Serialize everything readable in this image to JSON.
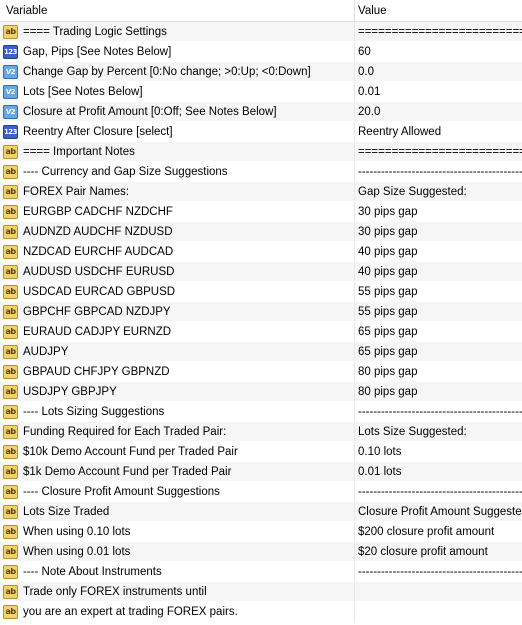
{
  "header": {
    "variable": "Variable",
    "value": "Value"
  },
  "rows": [
    {
      "icon": "ab-icon",
      "type": "ab",
      "var": "==== Trading Logic Settings",
      "val": "=================================="
    },
    {
      "icon": "int-icon",
      "type": "num",
      "var": "Gap, Pips [See Notes Below]",
      "val": "60"
    },
    {
      "icon": "double-icon",
      "type": "dbl",
      "var": "Change Gap by Percent [0:No change; >0:Up; <0:Down]",
      "val": "0.0"
    },
    {
      "icon": "double-icon",
      "type": "dbl",
      "var": "Lots [See Notes Below]",
      "val": "0.01"
    },
    {
      "icon": "double-icon",
      "type": "dbl",
      "var": "Closure at Profit Amount [0:Off; See Notes Below]",
      "val": "20.0"
    },
    {
      "icon": "int-icon",
      "type": "num",
      "var": "Reentry After Closure [select]",
      "val": "Reentry Allowed"
    },
    {
      "icon": "ab-icon",
      "type": "ab",
      "var": "==== Important Notes",
      "val": "=================================="
    },
    {
      "icon": "ab-icon",
      "type": "ab",
      "var": "---- Currency and Gap Size Suggestions",
      "val": "---------------------------------------------"
    },
    {
      "icon": "ab-icon",
      "type": "ab",
      "var": "FOREX Pair Names:",
      "val": "Gap Size Suggested:"
    },
    {
      "icon": "ab-icon",
      "type": "ab",
      "var": "EURGBP CADCHF NZDCHF",
      "val": "30 pips gap"
    },
    {
      "icon": "ab-icon",
      "type": "ab",
      "var": "AUDNZD AUDCHF NZDUSD",
      "val": "30 pips gap"
    },
    {
      "icon": "ab-icon",
      "type": "ab",
      "var": "NZDCAD EURCHF AUDCAD",
      "val": "40 pips gap"
    },
    {
      "icon": "ab-icon",
      "type": "ab",
      "var": "AUDUSD USDCHF EURUSD",
      "val": "40 pips gap"
    },
    {
      "icon": "ab-icon",
      "type": "ab",
      "var": "USDCAD EURCAD GBPUSD",
      "val": "55 pips gap"
    },
    {
      "icon": "ab-icon",
      "type": "ab",
      "var": "GBPCHF GBPCAD NZDJPY",
      "val": "55 pips gap"
    },
    {
      "icon": "ab-icon",
      "type": "ab",
      "var": "EURAUD CADJPY EURNZD",
      "val": "65 pips gap"
    },
    {
      "icon": "ab-icon",
      "type": "ab",
      "var": "AUDJPY",
      "val": "65 pips gap"
    },
    {
      "icon": "ab-icon",
      "type": "ab",
      "var": "GBPAUD CHFJPY GBPNZD",
      "val": "80 pips gap"
    },
    {
      "icon": "ab-icon",
      "type": "ab",
      "var": "USDJPY GBPJPY",
      "val": "80 pips gap"
    },
    {
      "icon": "ab-icon",
      "type": "ab",
      "var": "---- Lots Sizing Suggestions",
      "val": "---------------------------------------------"
    },
    {
      "icon": "ab-icon",
      "type": "ab",
      "var": "Funding Required for Each Traded Pair:",
      "val": "Lots Size Suggested:"
    },
    {
      "icon": "ab-icon",
      "type": "ab",
      "var": "$10k Demo Account Fund per Traded Pair",
      "val": "0.10 lots"
    },
    {
      "icon": "ab-icon",
      "type": "ab",
      "var": "$1k Demo Account Fund per Traded Pair",
      "val": "0.01 lots"
    },
    {
      "icon": "ab-icon",
      "type": "ab",
      "var": "---- Closure Profit Amount Suggestions",
      "val": "---------------------------------------------"
    },
    {
      "icon": "ab-icon",
      "type": "ab",
      "var": "Lots Size Traded",
      "val": "Closure Profit Amount Suggested:"
    },
    {
      "icon": "ab-icon",
      "type": "ab",
      "var": "When using 0.10 lots",
      "val": "$200 closure profit amount"
    },
    {
      "icon": "ab-icon",
      "type": "ab",
      "var": "When using 0.01 lots",
      "val": "$20 closure profit amount"
    },
    {
      "icon": "ab-icon",
      "type": "ab",
      "var": "---- Note About Instruments",
      "val": "---------------------------------------------"
    },
    {
      "icon": "ab-icon",
      "type": "ab",
      "var": "Trade only FOREX instruments until",
      "val": ""
    },
    {
      "icon": "ab-icon",
      "type": "ab",
      "var": "you are an expert at trading FOREX pairs.",
      "val": ""
    }
  ],
  "icon_glyphs": {
    "ab": "ab",
    "num": "123",
    "dbl": "V2"
  }
}
